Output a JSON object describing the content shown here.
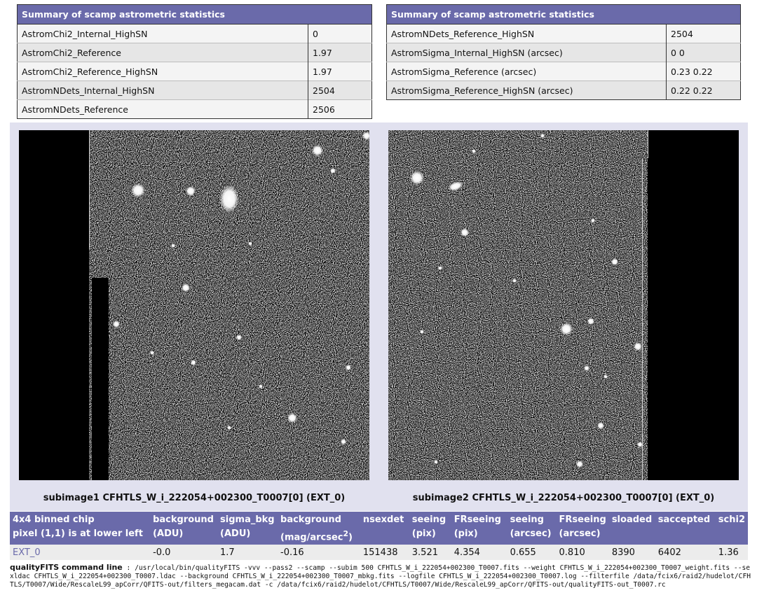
{
  "summary_left": {
    "title": "Summary of scamp astrometric statistics",
    "rows": [
      {
        "key": "AstromChi2_Internal_HighSN",
        "value": "0"
      },
      {
        "key": "AstromChi2_Reference",
        "value": "1.97"
      },
      {
        "key": "AstromChi2_Reference_HighSN",
        "value": "1.97"
      },
      {
        "key": "AstromNDets_Internal_HighSN",
        "value": "2504"
      },
      {
        "key": "AstromNDets_Reference",
        "value": "2506"
      }
    ]
  },
  "summary_right": {
    "title": "Summary of scamp astrometric statistics",
    "rows": [
      {
        "key": "AstromNDets_Reference_HighSN",
        "value": "2504"
      },
      {
        "key": "AstromSigma_Internal_HighSN (arcsec)",
        "value": "0 0"
      },
      {
        "key": "AstromSigma_Reference (arcsec)",
        "value": "0.23 0.22"
      },
      {
        "key": "AstromSigma_Reference_HighSN (arcsec)",
        "value": "0.22 0.22"
      }
    ]
  },
  "subimages": [
    {
      "caption": "subimage1 CFHTLS_W_i_222054+002300_T0007[0] (EXT_0)"
    },
    {
      "caption": "subimage2 CFHTLS_W_i_222054+002300_T0007[0] (EXT_0)"
    }
  ],
  "chip_table": {
    "headers": [
      {
        "l1": "4x4 binned chip",
        "l2": "pixel (1,1) is at lower left"
      },
      {
        "l1": "background",
        "l2": "(ADU)"
      },
      {
        "l1": "sigma_bkg",
        "l2": "(ADU)"
      },
      {
        "l1": "background",
        "l2": "(mag/arcsec",
        "sup": "2",
        "l2b": ")"
      },
      {
        "l1": "nsexdet",
        "l2": ""
      },
      {
        "l1": "seeing",
        "l2": "(pix)"
      },
      {
        "l1": "FRseeing",
        "l2": "(pix)"
      },
      {
        "l1": "seeing",
        "l2": "(arcsec)"
      },
      {
        "l1": "FRseeing",
        "l2": "(arcsec)"
      },
      {
        "l1": "sloaded",
        "l2": ""
      },
      {
        "l1": "saccepted",
        "l2": ""
      },
      {
        "l1": "schi2",
        "l2": ""
      }
    ],
    "row": [
      "EXT_0",
      "-0.0",
      "1.7",
      "-0.16",
      "151438",
      "3.521",
      "4.354",
      "0.655",
      "0.810",
      "8390",
      "6402",
      "1.36"
    ]
  },
  "command_line": {
    "label": "qualityFITS command line",
    "text": " : /usr/local/bin/qualityFITS -vvv --pass2 --scamp --subim 500 CFHTLS_W_i_222054+002300_T0007.fits --weight CFHTLS_W_i_222054+002300_T0007_weight.fits --sexldac CFHTLS_W_i_222054+002300_T0007.ldac --background CFHTLS_W_i_222054+002300_T0007_mbkg.fits --logfile CFHTLS_W_i_222054+002300_T0007.log --filterfile /data/fcix6/raid2/hudelot/CFHTLS/T0007/Wide/RescaleL99_apCorr/QFITS-out/filters_megacam.dat -c /data/fcix6/raid2/hudelot/CFHTLS/T0007/Wide/RescaleL99_apCorr/QFITS-out/qualityFITS-out_T0007.rc"
  },
  "colors": {
    "header_bg": "#6a6aaa",
    "panel_bg": "#e1e1ef"
  }
}
